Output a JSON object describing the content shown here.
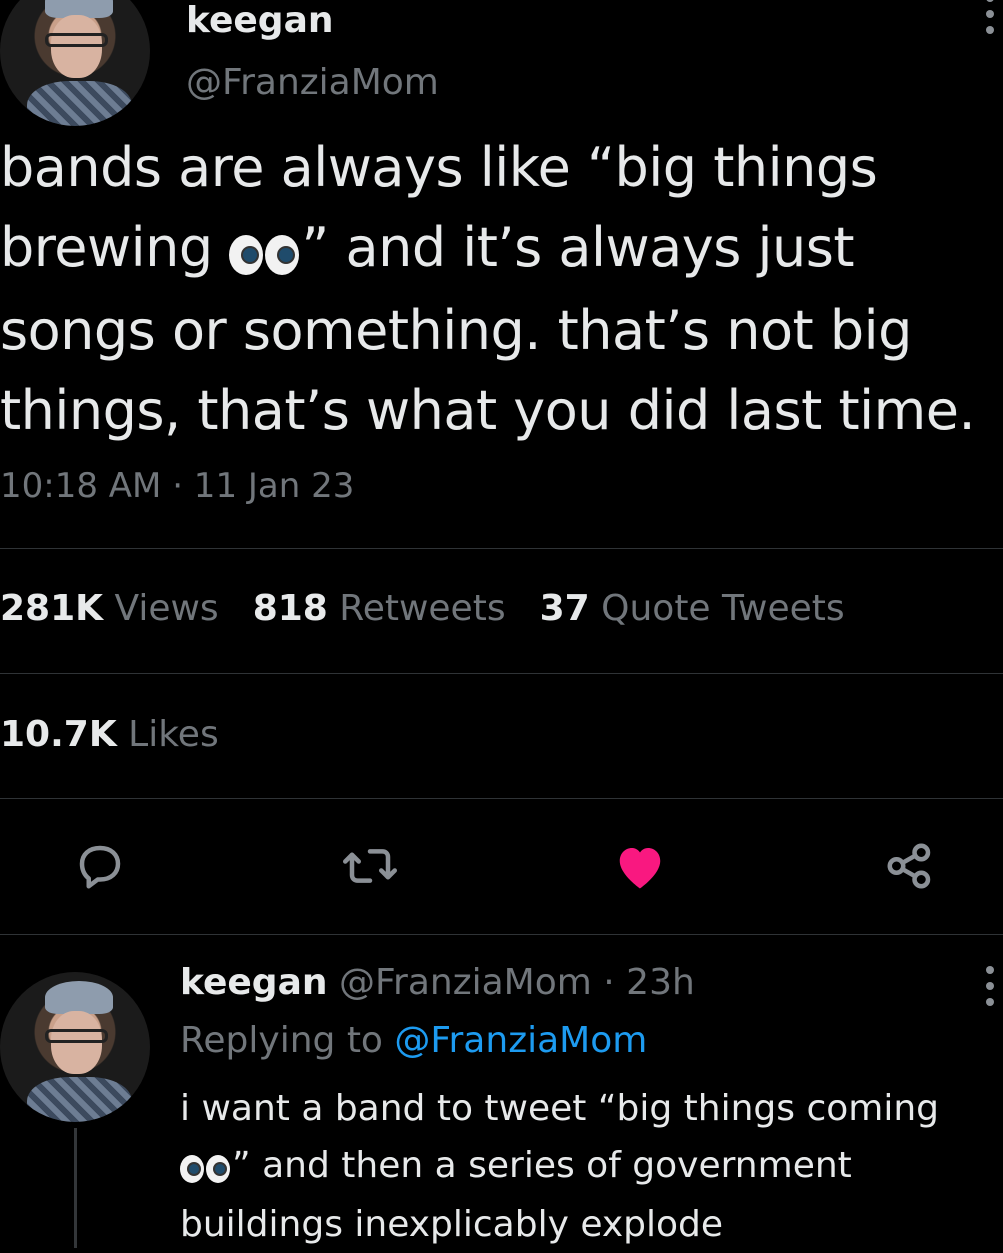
{
  "author": {
    "name": "keegan",
    "handle": "@FranziaMom"
  },
  "tweet": {
    "line1": "bands are always like “big things",
    "line2_pre": "brewing ",
    "line2_post": "” and it’s always just",
    "line3": "songs or something. that’s not big",
    "line4": "things, that’s what you did last time.",
    "timestamp": "10:18 AM · 11 Jan 23"
  },
  "stats": {
    "views_count": "281K",
    "views_label": "Views",
    "retweets_count": "818",
    "retweets_label": "Retweets",
    "quotes_count": "37",
    "quotes_label": "Quote Tweets",
    "likes_count": "10.7K",
    "likes_label": "Likes"
  },
  "actions": {
    "reply_icon": "reply-icon",
    "retweet_icon": "retweet-icon",
    "like_icon": "heart-icon",
    "share_icon": "share-icon",
    "like_color": "#f91880"
  },
  "reply": {
    "name": "keegan",
    "meta": "@FranziaMom · 23h",
    "replying_prefix": "Replying to",
    "replying_handle": "@FranziaMom",
    "line1": "i want a band to tweet “big things coming",
    "line2_post": "” and then a series of government",
    "line3": "buildings inexplicably explode"
  }
}
